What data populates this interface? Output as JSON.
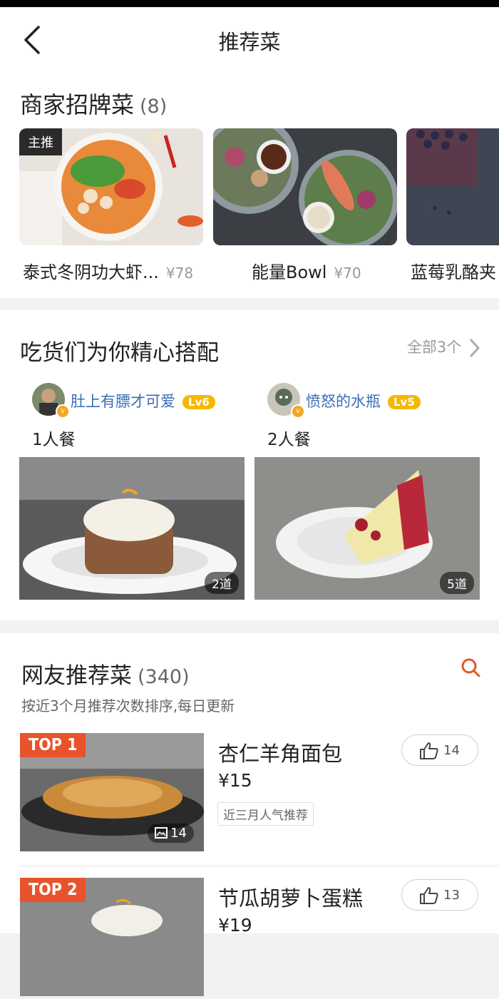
{
  "nav": {
    "title": "推荐菜",
    "back_icon": "chevron-left-icon"
  },
  "signature": {
    "title": "商家招牌菜",
    "count": "(8)",
    "items": [
      {
        "name": "泰式冬阴功大虾...",
        "price": "¥78",
        "badge": "主推"
      },
      {
        "name": "能量Bowl",
        "price": "¥70"
      },
      {
        "name": "蓝莓乳酪夹",
        "price": ""
      }
    ]
  },
  "combos": {
    "title": "吃货们为你精心搭配",
    "see_all": "全部3个",
    "items": [
      {
        "user": "肚上有膘才可爱",
        "level": "Lv6",
        "label": "1人餐",
        "dishes": "2道"
      },
      {
        "user": "愤怒的水瓶",
        "level": "Lv5",
        "label": "2人餐",
        "dishes": "5道"
      }
    ]
  },
  "ranking": {
    "title": "网友推荐菜",
    "count": "(340)",
    "subtitle": "按近3个月推荐次数排序,每日更新",
    "items": [
      {
        "rank": "TOP 1",
        "name": "杏仁羊角面包",
        "price": "¥15",
        "tag": "近三月人气推荐",
        "photos": "14",
        "likes": "14"
      },
      {
        "rank": "TOP 2",
        "name": "节瓜胡萝卜蛋糕",
        "price": "¥19",
        "likes": "13"
      }
    ]
  },
  "colors": {
    "accent": "#e8532b",
    "level_badge": "#f5b800",
    "username": "#3a6db5"
  }
}
